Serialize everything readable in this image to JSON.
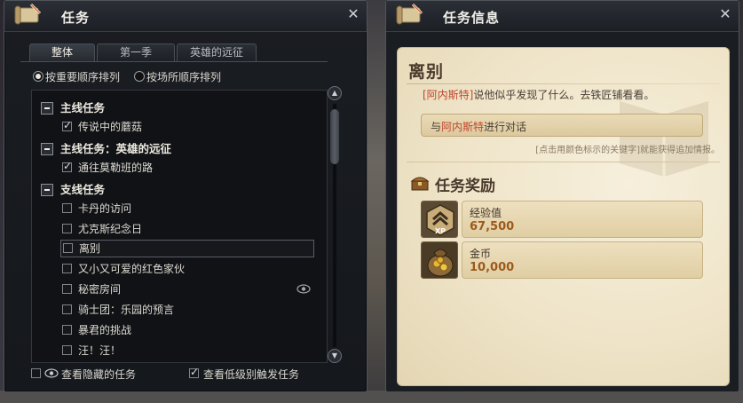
{
  "quest_window": {
    "title": "任务",
    "tabs": [
      "整体",
      "第一季",
      "英雄的远征"
    ],
    "sort_options": [
      "按重要顺序排列",
      "按场所顺序排列"
    ],
    "selected_sort": "按重要顺序排列",
    "categories": [
      {
        "label": "主线任务",
        "items": [
          {
            "label": "传说中的蘑菇",
            "checked": true
          }
        ]
      },
      {
        "label": "主线任务：英雄的远征",
        "items": [
          {
            "label": "通往莫勒班的路",
            "checked": true
          }
        ]
      },
      {
        "label": "支线任务",
        "items": [
          {
            "label": "卡丹的访问",
            "checked": false
          },
          {
            "label": "尤克斯纪念日",
            "checked": false
          },
          {
            "label": "离别",
            "checked": false,
            "selected": true
          },
          {
            "label": "又小又可爱的红色家伙",
            "checked": false
          },
          {
            "label": "秘密房间",
            "checked": false
          },
          {
            "label": "骑士团：乐园的预言",
            "checked": false
          },
          {
            "label": "暴君的挑战",
            "checked": false
          },
          {
            "label": "汪！汪！",
            "checked": false
          }
        ]
      }
    ],
    "show_hidden_label": "查看隐藏的任务",
    "show_hidden_checked": false,
    "show_low_level_label": "查看低级别触发任务",
    "show_low_level_checked": true
  },
  "info_window": {
    "title": "任务信息",
    "quest_name": "离别",
    "description_keyword": "[阿内斯特]",
    "description_rest": "说他似乎发现了什么。去铁匠铺看看。",
    "objective_prefix": "与",
    "objective_keyword": "阿内斯特",
    "objective_suffix": "进行对话",
    "hint": "[点击用颜色标示的关键字]就能获得追加情报。",
    "reward_title": "任务奖励",
    "rewards": [
      {
        "label": "经验值",
        "value": "67,500",
        "icon": "xp-icon",
        "icon_text": "XP"
      },
      {
        "label": "金币",
        "value": "10,000",
        "icon": "gold-coin-bag-icon"
      }
    ]
  },
  "colors": {
    "keyword": "#c1462c",
    "reward_value": "#9c5a1c",
    "parchment": "#efe4c8"
  }
}
